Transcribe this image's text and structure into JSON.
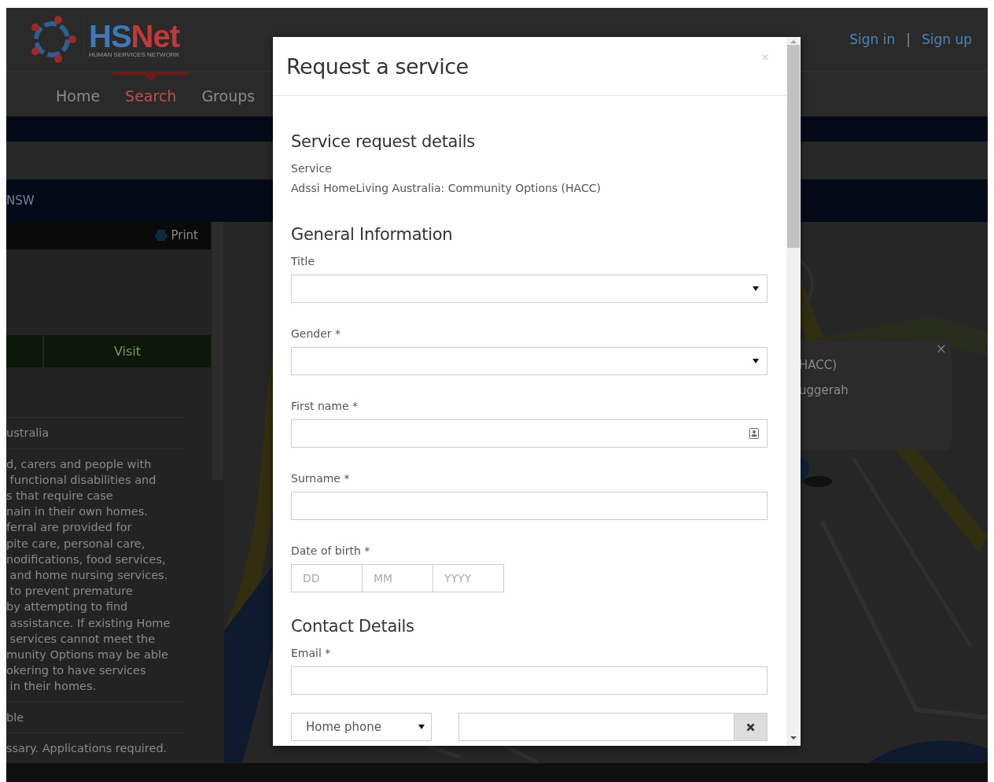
{
  "header": {
    "logo_text": [
      {
        "text": "HS",
        "color": "#3f78b4"
      },
      {
        "text": "Net",
        "color": "#c03838"
      }
    ],
    "tagline": "HUMAN SERVICES NETWORK",
    "auth_links": [
      {
        "label": "Sign in"
      },
      {
        "label": "Sign up"
      }
    ],
    "separator": "|"
  },
  "nav": [
    {
      "label": "Home",
      "selected": false
    },
    {
      "label": "Search",
      "selected": true
    },
    {
      "label": "Groups",
      "selected": false
    }
  ],
  "location_bar": {
    "text": "NSW"
  },
  "detail_panel": {
    "print_label": "Print",
    "action": "Visit",
    "rows": [
      {
        "text": "ustralia"
      },
      {
        "text": "d, carers and people with\n functional disabilities and\ns that require case\nnain in their own homes.\nferral are provided for\npite care, personal care,\nnodifications, food services,\n and home nursing services.\n to prevent premature\nby attempting to find\n assistance. If existing Home\n services cannot meet the\nmunity Options may be able\nokering to have services\n in their homes."
      },
      {
        "text": "ble"
      },
      {
        "text": "ssary. Applications required."
      }
    ]
  },
  "map_popup": {
    "lines": [
      "HACC)",
      "uggerah"
    ],
    "close": "×"
  },
  "modal": {
    "title": "Request a service",
    "close": "×",
    "sections": [
      {
        "heading": "Service request details",
        "items": [
          {
            "kind": "info",
            "label": "Service",
            "value": "Adssi HomeLiving Australia: Community Options (HACC)"
          }
        ]
      },
      {
        "heading": "General Information",
        "items": [
          {
            "kind": "select",
            "label": "Title"
          },
          {
            "kind": "select",
            "label": "Gender *"
          },
          {
            "kind": "contact",
            "label": "First name *"
          },
          {
            "kind": "text",
            "label": "Surname *"
          },
          {
            "kind": "date",
            "label": "Date of birth *",
            "placeholders": [
              "DD",
              "MM",
              "YYYY"
            ]
          }
        ]
      },
      {
        "heading": "Contact Details",
        "items": [
          {
            "kind": "text",
            "label": "Email *"
          },
          {
            "kind": "phone",
            "value": "Home phone"
          }
        ]
      }
    ]
  }
}
